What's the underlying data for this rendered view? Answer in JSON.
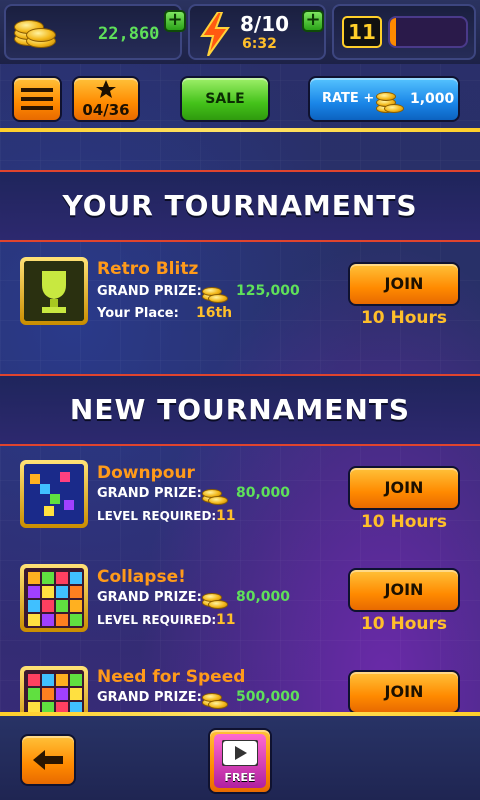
{
  "topbar": {
    "coins": "22,860",
    "energy": "8/10",
    "energy_timer": "6:32",
    "level": "11"
  },
  "nav": {
    "stars_progress": "04/36",
    "sale_label": "SALE",
    "rate_label": "RATE +",
    "rate_reward": "1,000"
  },
  "your_tournaments": {
    "heading": "YOUR TOURNAMENTS",
    "items": [
      {
        "name": "Retro Blitz",
        "prize_label": "GRAND PRIZE:",
        "prize": "125,000",
        "place_label": "Your Place:",
        "place": "16th",
        "join_label": "JOIN",
        "duration": "10 Hours"
      }
    ]
  },
  "new_tournaments": {
    "heading": "NEW TOURNAMENTS",
    "items": [
      {
        "name": "Downpour",
        "prize_label": "GRAND PRIZE:",
        "prize": "80,000",
        "req_label": "LEVEL REQUIRED:",
        "req": "11",
        "join_label": "JOIN",
        "duration": "10 Hours"
      },
      {
        "name": "Collapse!",
        "prize_label": "GRAND PRIZE:",
        "prize": "80,000",
        "req_label": "LEVEL REQUIRED:",
        "req": "11",
        "join_label": "JOIN",
        "duration": "10 Hours"
      },
      {
        "name": "Need for Speed",
        "prize_label": "GRAND PRIZE:",
        "prize": "500,000",
        "join_label": "JOIN"
      }
    ]
  },
  "bottom": {
    "free_label": "FREE"
  },
  "colors": {
    "accent_orange": "#ff8a00",
    "prize_green": "#5fe05a",
    "highlight_gold": "#ffbf2a",
    "divider_red": "#e0442e"
  }
}
